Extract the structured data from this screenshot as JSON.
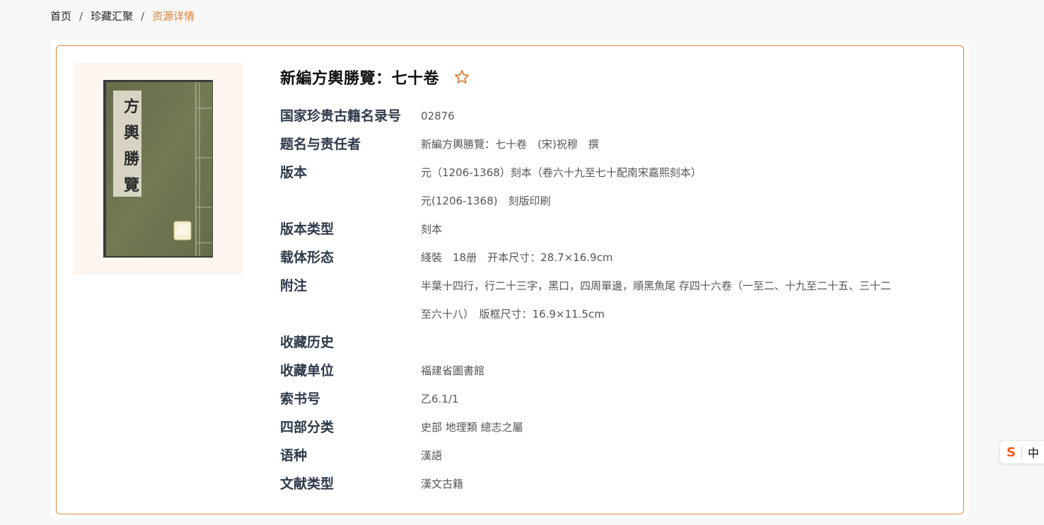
{
  "breadcrumb": {
    "home": "首页",
    "collection": "珍藏汇聚",
    "current": "资源详情",
    "separator": "/"
  },
  "book": {
    "title": "新編方輿勝覽：七十卷",
    "cover_text": [
      "方",
      "輿",
      "勝",
      "覽"
    ],
    "favorite_icon": "star-outline-icon"
  },
  "fields": [
    {
      "label": "国家珍贵古籍名录号",
      "values": [
        "02876"
      ]
    },
    {
      "label": "题名与责任者",
      "values": [
        "新編方輿勝覽：七十卷　(宋)祝穆　撰"
      ]
    },
    {
      "label": "版本",
      "values": [
        "元（1206-1368）刻本（卷六十九至七十配南宋嘉熙刻本）",
        "元(1206-1368)　刻版印刷"
      ]
    },
    {
      "label": "版本类型",
      "values": [
        "刻本"
      ]
    },
    {
      "label": "载体形态",
      "values": [
        "綫裝　18册　开本尺寸：28.7×16.9cm"
      ]
    },
    {
      "label": "附注",
      "values": [
        "半葉十四行，行二十三字，黑口，四周單邊，順黑魚尾  存四十六卷（一至二、十九至二十五、三十二",
        "至六十八）　版框尺寸：16.9×11.5cm"
      ]
    },
    {
      "label": "收藏历史",
      "values": [
        ""
      ]
    },
    {
      "label": "收藏单位",
      "values": [
        "福建省圖書館"
      ]
    },
    {
      "label": "索书号",
      "values": [
        "乙6.1/1"
      ]
    },
    {
      "label": "四部分类",
      "values": [
        "史部 地理類 總志之屬"
      ]
    },
    {
      "label": "语种",
      "values": [
        "漢語"
      ]
    },
    {
      "label": "文献类型",
      "values": [
        "漢文古籍"
      ]
    }
  ],
  "ime": {
    "logo": "S",
    "mode": "中"
  },
  "colors": {
    "accent": "#d9823b",
    "border": "#d9893f",
    "cover_bg": "#fdf5ef"
  }
}
